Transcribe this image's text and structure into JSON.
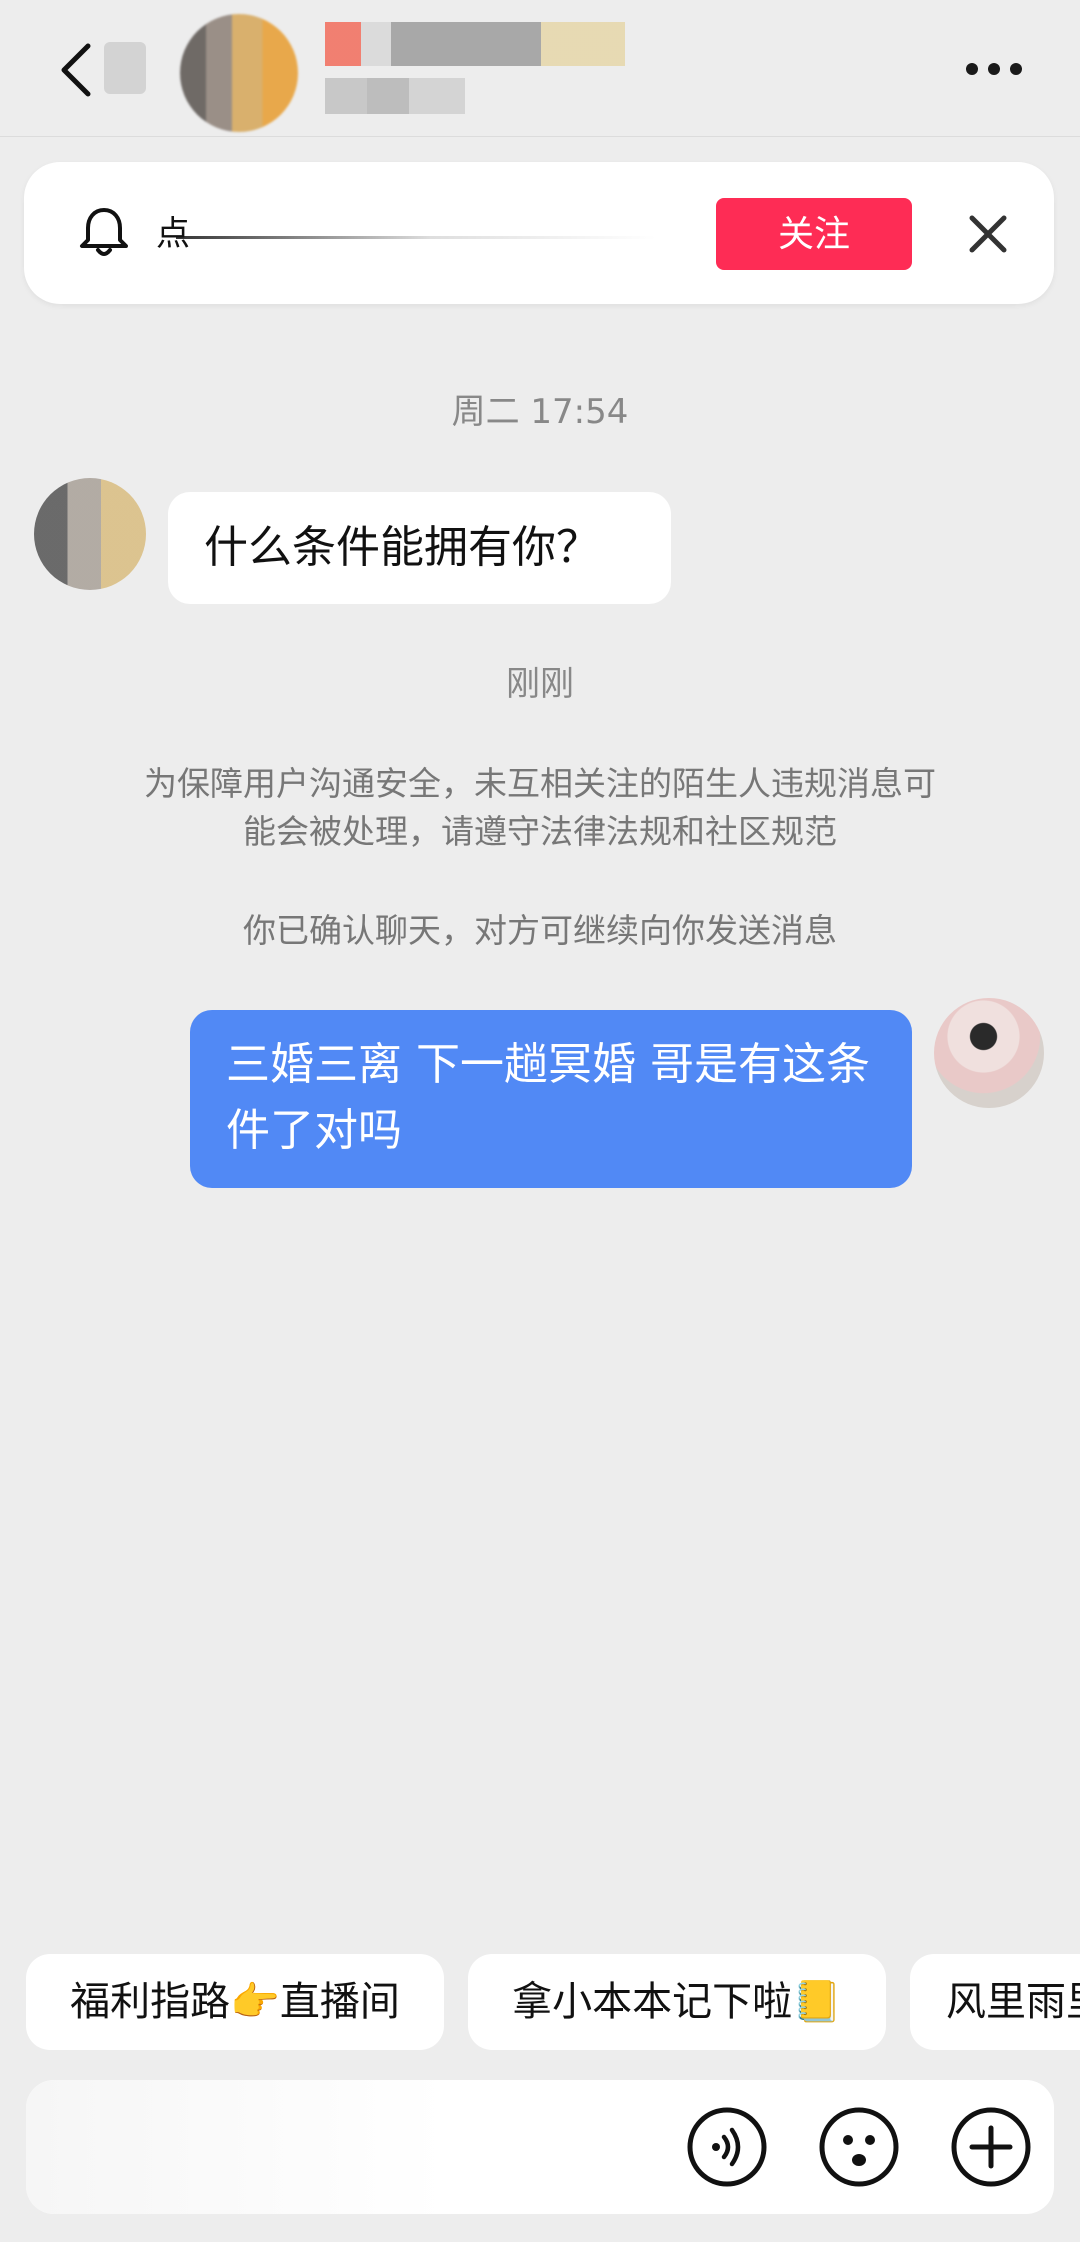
{
  "header": {
    "back_icon": "chevron-left-icon",
    "more_icon": "more-horizontal-icon"
  },
  "notice": {
    "bell_icon": "bell-icon",
    "text": "点",
    "follow_label": "关注",
    "close_icon": "close-icon"
  },
  "messages": {
    "time_1": "周二 17:54",
    "incoming_text": "什么条件能拥有你？",
    "time_2": "刚刚",
    "system_notice": "为保障用户沟通安全，未互相关注的陌生人违规消息可能会被处理，请遵守法律法规和社区规范",
    "system_confirm": "你已确认聊天，对方可继续向你发送消息",
    "outgoing_text": "三婚三离 下一趟冥婚 哥是有这条件了对吗"
  },
  "quick_replies": [
    "福利指路👉直播间",
    "拿小本本记下啦📒",
    "风里雨里"
  ],
  "input_bar": {
    "voice_icon": "voice-icon",
    "emoji_icon": "emoji-icon",
    "plus_icon": "plus-icon"
  },
  "colors": {
    "follow": "#fe2c55",
    "outgoing_bubble": "#5189f5",
    "background": "#ededed"
  }
}
